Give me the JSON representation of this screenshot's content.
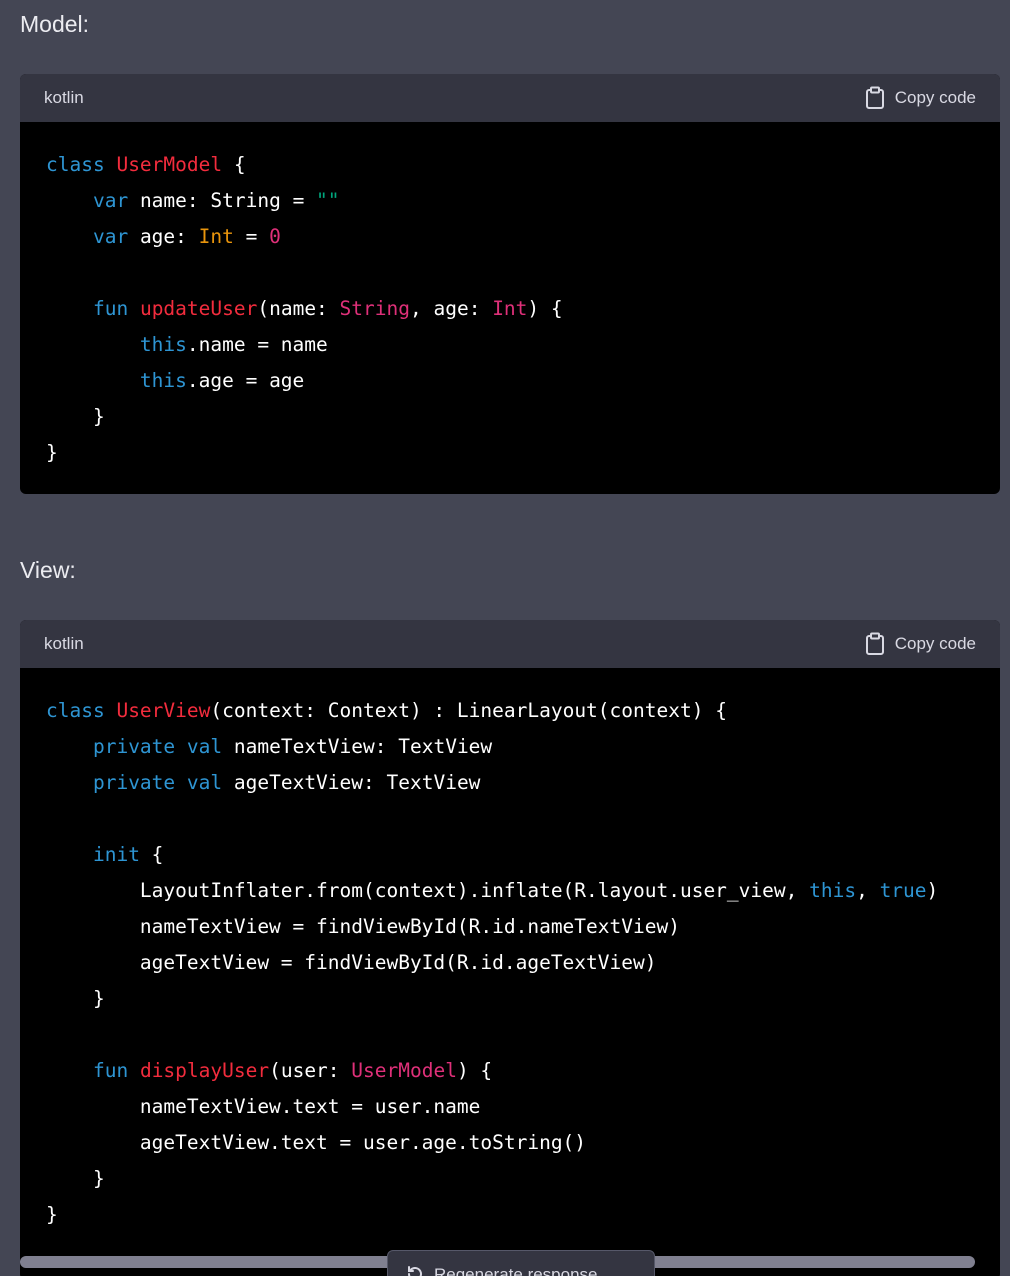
{
  "sections": [
    {
      "label": "Model:",
      "language": "kotlin",
      "copy_label": "Copy code"
    },
    {
      "label": "View:",
      "language": "kotlin",
      "copy_label": "Copy code"
    }
  ],
  "regenerate_label": "Regenerate response",
  "icons": [
    "clipboard-icon",
    "refresh-icon"
  ],
  "colors": {
    "background": "#444654",
    "code_header": "#343541",
    "code_body": "#000000",
    "keyword": "#2e95d3",
    "class_name": "#f22c3d",
    "type": "#df3079",
    "string": "#00a67d"
  },
  "code_model": [
    [
      [
        "kw",
        "class"
      ],
      [
        "p",
        " "
      ],
      [
        "cls",
        "UserModel"
      ],
      [
        "p",
        " {"
      ]
    ],
    [
      [
        "p",
        "    "
      ],
      [
        "kw",
        "var"
      ],
      [
        "p",
        " name: String = "
      ],
      [
        "str",
        "\"\""
      ]
    ],
    [
      [
        "p",
        "    "
      ],
      [
        "kw",
        "var"
      ],
      [
        "p",
        " age: "
      ],
      [
        "int",
        "Int"
      ],
      [
        "p",
        " = "
      ],
      [
        "num",
        "0"
      ]
    ],
    [
      [
        "p",
        ""
      ]
    ],
    [
      [
        "p",
        "    "
      ],
      [
        "kw",
        "fun"
      ],
      [
        "p",
        " "
      ],
      [
        "cls",
        "updateUser"
      ],
      [
        "p",
        "(name: "
      ],
      [
        "ty",
        "String"
      ],
      [
        "p",
        ", age: "
      ],
      [
        "ty",
        "Int"
      ],
      [
        "p",
        ") {"
      ]
    ],
    [
      [
        "p",
        "        "
      ],
      [
        "kw",
        "this"
      ],
      [
        "p",
        ".name = name"
      ]
    ],
    [
      [
        "p",
        "        "
      ],
      [
        "kw",
        "this"
      ],
      [
        "p",
        ".age = age"
      ]
    ],
    [
      [
        "p",
        "    }"
      ]
    ],
    [
      [
        "p",
        "}"
      ]
    ]
  ],
  "code_view": [
    [
      [
        "kw",
        "class"
      ],
      [
        "p",
        " "
      ],
      [
        "cls",
        "UserView"
      ],
      [
        "p",
        "(context: Context) : LinearLayout(context) {"
      ]
    ],
    [
      [
        "p",
        "    "
      ],
      [
        "kw",
        "private"
      ],
      [
        "p",
        " "
      ],
      [
        "kw",
        "val"
      ],
      [
        "p",
        " nameTextView: TextView"
      ]
    ],
    [
      [
        "p",
        "    "
      ],
      [
        "kw",
        "private"
      ],
      [
        "p",
        " "
      ],
      [
        "kw",
        "val"
      ],
      [
        "p",
        " ageTextView: TextView"
      ]
    ],
    [
      [
        "p",
        ""
      ]
    ],
    [
      [
        "p",
        "    "
      ],
      [
        "kw",
        "init"
      ],
      [
        "p",
        " {"
      ]
    ],
    [
      [
        "p",
        "        LayoutInflater.from(context).inflate(R.layout.user_view, "
      ],
      [
        "kw",
        "this"
      ],
      [
        "p",
        ", "
      ],
      [
        "kw",
        "true"
      ],
      [
        "p",
        ")"
      ]
    ],
    [
      [
        "p",
        "        nameTextView = findViewById(R.id.nameTextView)"
      ]
    ],
    [
      [
        "p",
        "        ageTextView = findViewById(R.id.ageTextView)"
      ]
    ],
    [
      [
        "p",
        "    }"
      ]
    ],
    [
      [
        "p",
        ""
      ]
    ],
    [
      [
        "p",
        "    "
      ],
      [
        "kw",
        "fun"
      ],
      [
        "p",
        " "
      ],
      [
        "cls",
        "displayUser"
      ],
      [
        "p",
        "(user: "
      ],
      [
        "ty",
        "UserModel"
      ],
      [
        "p",
        ") {"
      ]
    ],
    [
      [
        "p",
        "        nameTextView.text = user.name"
      ]
    ],
    [
      [
        "p",
        "        ageTextView.text = user.age.toString()"
      ]
    ],
    [
      [
        "p",
        "    }"
      ]
    ],
    [
      [
        "p",
        "}"
      ]
    ]
  ]
}
